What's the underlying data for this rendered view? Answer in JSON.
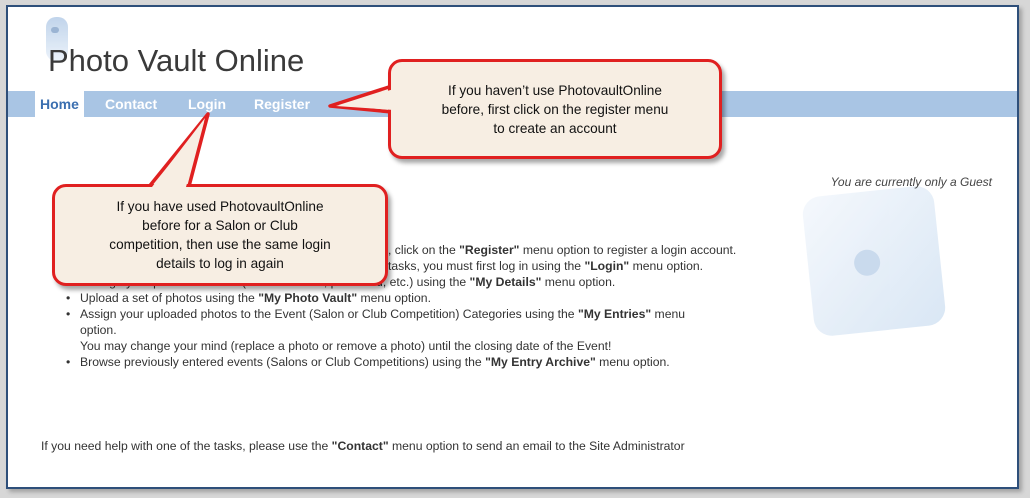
{
  "site": {
    "title": "Photo Vault Online"
  },
  "nav": {
    "items": [
      {
        "label": "Home"
      },
      {
        "label": "Contact"
      },
      {
        "label": "Login"
      },
      {
        "label": "Register"
      }
    ]
  },
  "status": {
    "guest": "You are currently only a Guest"
  },
  "content": {
    "heading_fragment": ":",
    "tasks": [
      {
        "pre": ", click on the ",
        "bold": "\"Register\"",
        "post": " menu option to register a login account."
      },
      {
        "pre": "tasks, you must first log in using the ",
        "bold": "\"Login\"",
        "post": " menu option."
      },
      {
        "pre": "Change your personal details (contact details, password, etc.) using the ",
        "bold": "\"My Details\"",
        "post": " menu option."
      },
      {
        "pre": "Upload a set of photos using the ",
        "bold": "\"My Photo Vault\"",
        "post": " menu option."
      },
      {
        "pre": "Assign your uploaded photos to the Event (Salon or Club Competition) Categories using the ",
        "bold": "\"My Entries\"",
        "post": " menu"
      },
      {
        "pre": "option.",
        "bold": "",
        "post": ""
      },
      {
        "pre": "You may change your mind (replace a photo or remove a photo) until the closing date of the Event!",
        "bold": "",
        "post": ""
      },
      {
        "pre": "Browse previously entered events (Salons or Club Competitions) using the ",
        "bold": "\"My Entry Archive\"",
        "post": " menu option."
      }
    ],
    "help": {
      "pre": "If you need help with one of the tasks, please use the ",
      "bold": "\"Contact\"",
      "post": " menu option to send an email to the Site Administrator"
    }
  },
  "callouts": {
    "register": {
      "lines": [
        "If you haven’t use PhotovaultOnline",
        "before, first click on the register menu",
        "to create an account"
      ]
    },
    "login": {
      "lines": [
        "If you have used PhotovaultOnline",
        "before for a Salon or Club",
        "competition, then use the same login",
        "details to log in again"
      ]
    }
  },
  "colors": {
    "nav_bg": "#a9c5e4",
    "callout_border": "#e02020",
    "callout_fill": "#f7eee3",
    "frame_border": "#2e4f7a"
  }
}
